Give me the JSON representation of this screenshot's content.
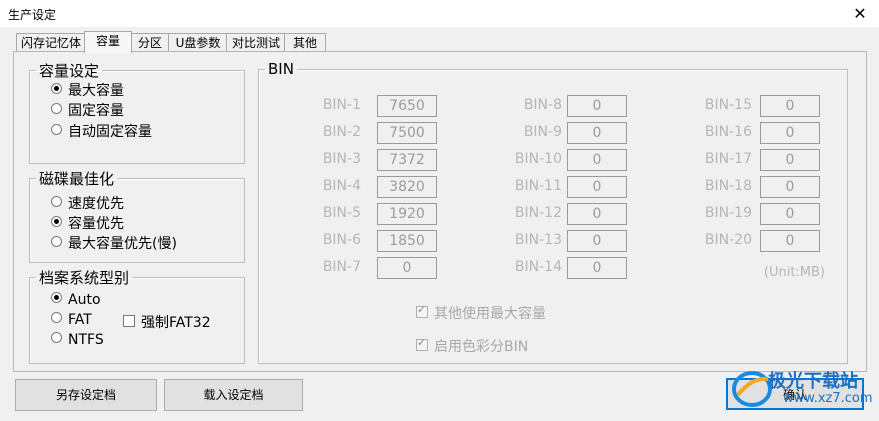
{
  "window": {
    "title": "生产设定",
    "close_glyph": "✕"
  },
  "tabs": [
    "闪存记忆体",
    "容量",
    "分区",
    "U盘参数",
    "对比测试",
    "其他"
  ],
  "capacity": {
    "legend": "容量设定",
    "options": [
      "最大容量",
      "固定容量",
      "自动固定容量"
    ],
    "selected": 0
  },
  "optimize": {
    "legend": "磁碟最佳化",
    "options": [
      "速度优先",
      "容量优先",
      "最大容量优先(慢)"
    ],
    "selected": 1
  },
  "filesystem": {
    "legend": "档案系统型别",
    "options": [
      "Auto",
      "FAT",
      "NTFS"
    ],
    "selected": 0,
    "force_fat32": {
      "label": "强制FAT32",
      "checked": false
    }
  },
  "bin": {
    "legend": "BIN",
    "col1": [
      {
        "label": "BIN-1",
        "value": "7650"
      },
      {
        "label": "BIN-2",
        "value": "7500"
      },
      {
        "label": "BIN-3",
        "value": "7372"
      },
      {
        "label": "BIN-4",
        "value": "3820"
      },
      {
        "label": "BIN-5",
        "value": "1920"
      },
      {
        "label": "BIN-6",
        "value": "1850"
      },
      {
        "label": "BIN-7",
        "value": "0"
      }
    ],
    "col2": [
      {
        "label": "BIN-8",
        "value": "0"
      },
      {
        "label": "BIN-9",
        "value": "0"
      },
      {
        "label": "BIN-10",
        "value": "0"
      },
      {
        "label": "BIN-11",
        "value": "0"
      },
      {
        "label": "BIN-12",
        "value": "0"
      },
      {
        "label": "BIN-13",
        "value": "0"
      },
      {
        "label": "BIN-14",
        "value": "0"
      }
    ],
    "col3": [
      {
        "label": "BIN-15",
        "value": "0"
      },
      {
        "label": "BIN-16",
        "value": "0"
      },
      {
        "label": "BIN-17",
        "value": "0"
      },
      {
        "label": "BIN-18",
        "value": "0"
      },
      {
        "label": "BIN-19",
        "value": "0"
      },
      {
        "label": "BIN-20",
        "value": "0"
      }
    ],
    "unit": "(Unit:MB)",
    "use_max_other": {
      "label": "其他使用最大容量",
      "checked": true
    },
    "color_bin": {
      "label": "启用色彩分BIN",
      "checked": true
    }
  },
  "buttons": {
    "save": "另存设定档",
    "load": "载入设定档",
    "ok": "确认"
  },
  "watermark": {
    "text": "极光下载站",
    "url": "www.xz7.com"
  }
}
